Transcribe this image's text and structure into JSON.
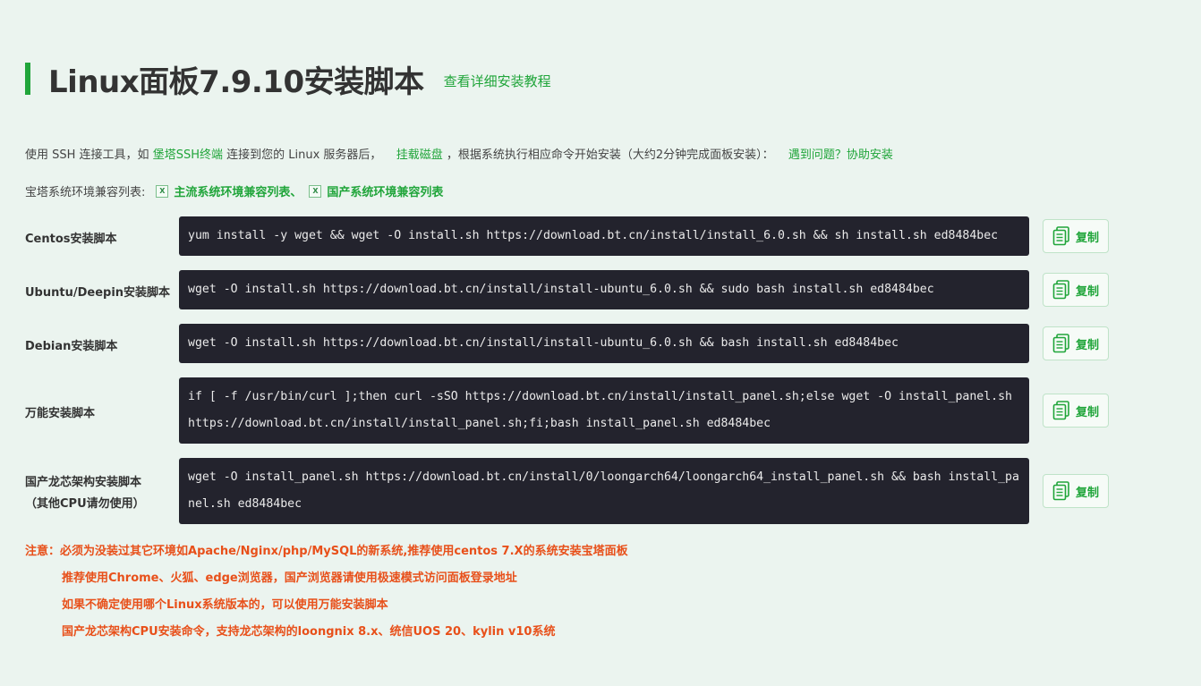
{
  "header": {
    "title": "Linux面板7.9.10安装脚本",
    "tutorial_link": "查看详细安装教程"
  },
  "intro": {
    "part1": "使用 SSH 连接工具，如",
    "link_terminal": "堡塔SSH终端",
    "part2": "连接到您的 Linux 服务器后，",
    "link_mount": "挂载磁盘",
    "part3": "，根据系统执行相应命令开始安装（大约2分钟完成面板安装）：",
    "link_help": "遇到问题？协助安装"
  },
  "compat": {
    "label": "宝塔系统环境兼容列表:",
    "link_mainstream": "主流系统环境兼容列表、",
    "link_domestic": "国产系统环境兼容列表"
  },
  "scripts": [
    {
      "label_line1": "Centos安装脚本",
      "label_line2": "",
      "command": "yum install -y wget && wget -O install.sh https://download.bt.cn/install/install_6.0.sh && sh install.sh ed8484bec",
      "copy": "复制"
    },
    {
      "label_line1": "Ubuntu/Deepin安装脚本",
      "label_line2": "",
      "command": "wget -O install.sh https://download.bt.cn/install/install-ubuntu_6.0.sh && sudo bash install.sh ed8484bec",
      "copy": "复制"
    },
    {
      "label_line1": "Debian安装脚本",
      "label_line2": "",
      "command": "wget -O install.sh https://download.bt.cn/install/install-ubuntu_6.0.sh && bash install.sh ed8484bec",
      "copy": "复制"
    },
    {
      "label_line1": "万能安装脚本",
      "label_line2": "",
      "command": "if [ -f /usr/bin/curl ];then curl -sSO https://download.bt.cn/install/install_panel.sh;else wget -O install_panel.sh https://download.bt.cn/install/install_panel.sh;fi;bash install_panel.sh ed8484bec",
      "copy": "复制"
    },
    {
      "label_line1": "国产龙芯架构安装脚本",
      "label_line2": "（其他CPU请勿使用）",
      "command": "wget -O install_panel.sh https://download.bt.cn/install/0/loongarch64/loongarch64_install_panel.sh && bash install_panel.sh ed8484bec",
      "copy": "复制"
    }
  ],
  "notes": {
    "prefix": "注意：",
    "line1": "必须为没装过其它环境如Apache/Nginx/php/MySQL的新系统,推荐使用centos 7.X的系统安装宝塔面板",
    "line2": "推荐使用Chrome、火狐、edge浏览器，国产浏览器请使用极速模式访问面板登录地址",
    "line3": "如果不确定使用哪个Linux系统版本的，可以使用万能安装脚本",
    "line4": "国产龙芯架构CPU安装命令，支持龙芯架构的loongnix 8.x、统信UOS 20、kylin v10系统"
  },
  "colors": {
    "accent": "#20a53a",
    "background": "#ebf4ef",
    "command_bg": "#23232d",
    "warning": "#e8501a"
  }
}
